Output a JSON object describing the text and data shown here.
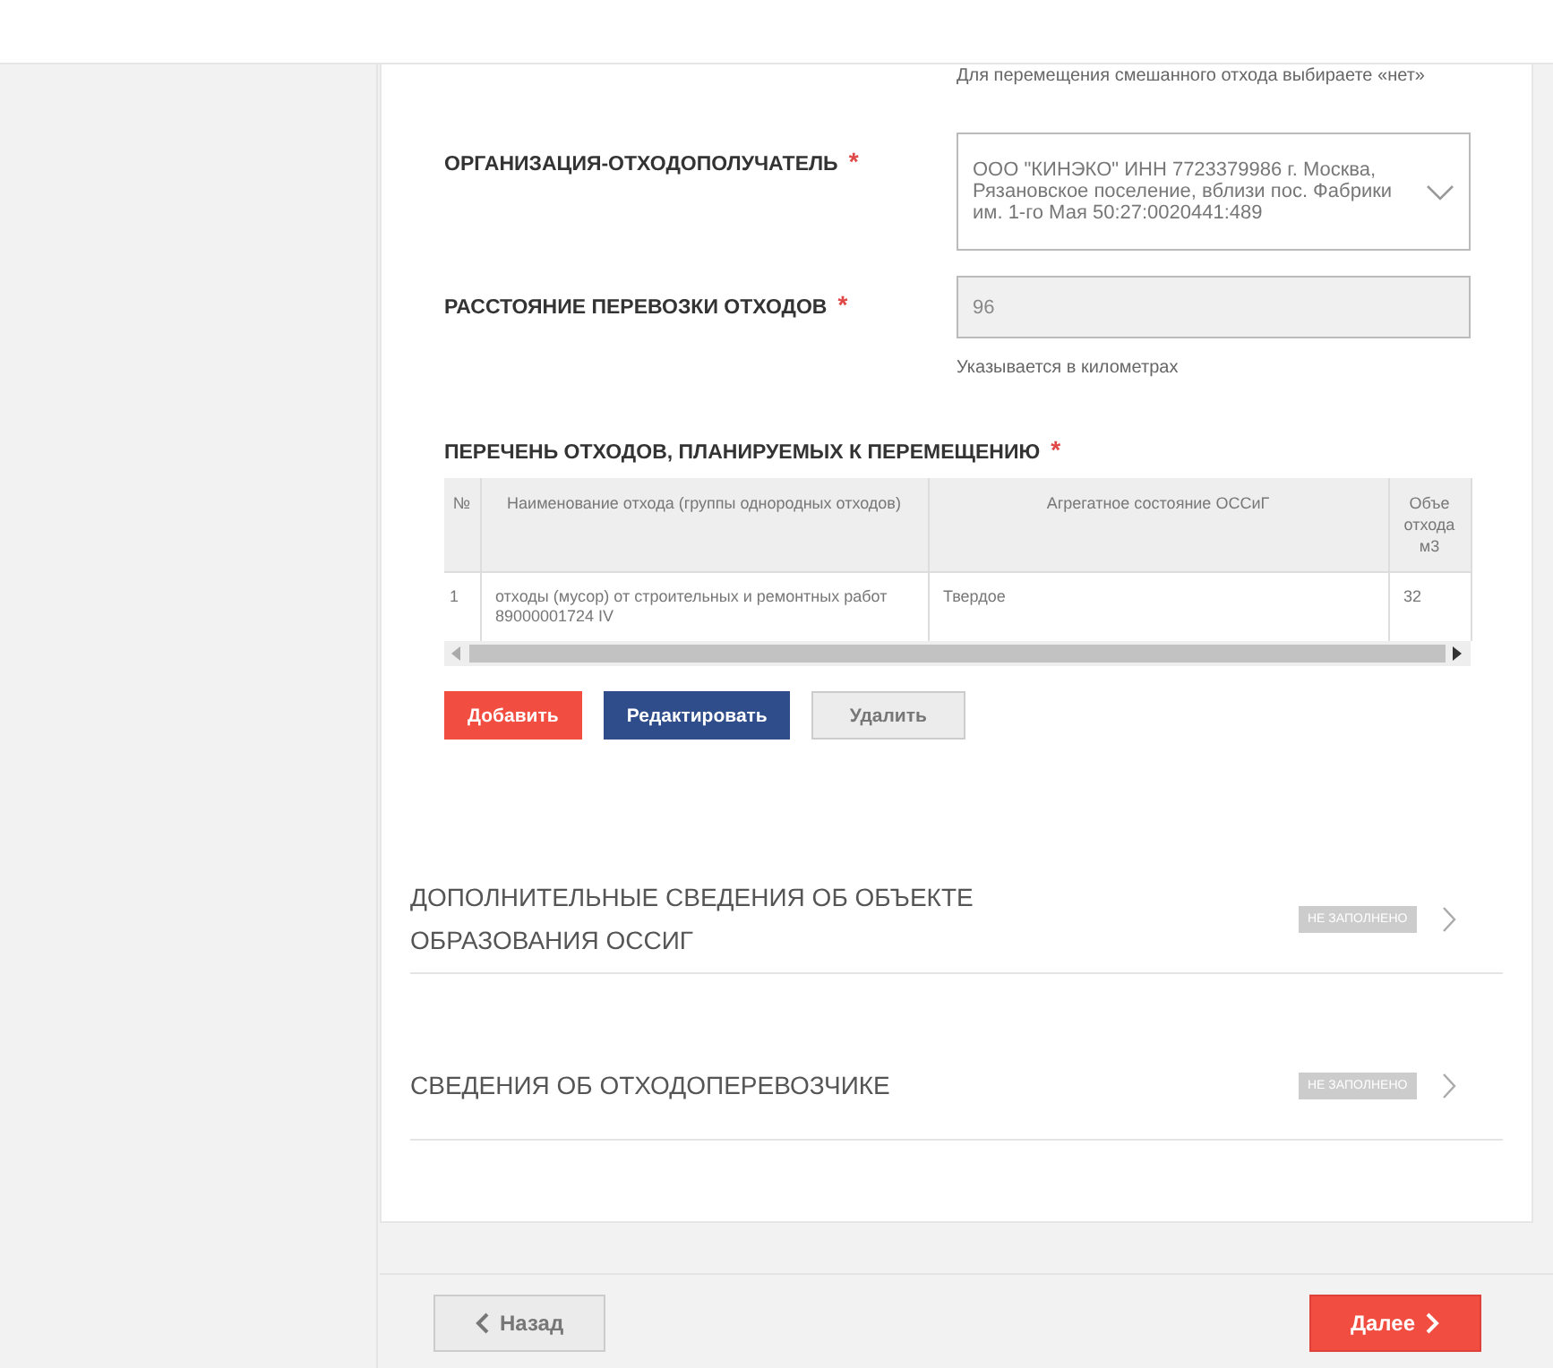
{
  "top_hint": "Для перемещения смешанного отхода выбираете «нет»",
  "fields": [
    {
      "kind": "select",
      "label": "ОРГАНИЗАЦИЯ-ОТХОДОПОЛУЧАТЕЛЬ",
      "required_mark": "*",
      "value": "ООО \"КИНЭКО\" ИНН 7723379986 г. Москва, Рязановское поселение, вблизи пос. Фабрики им. 1-го Мая 50:27:0020441:489",
      "disabled": false
    },
    {
      "kind": "input",
      "label": "РАССТОЯНИЕ ПЕРЕВОЗКИ ОТХОДОВ",
      "required_mark": "*",
      "value": "96",
      "disabled": true,
      "hint": "Указывается в километрах"
    }
  ],
  "waste_list": {
    "title": "ПЕРЕЧЕНЬ ОТХОДОВ, ПЛАНИРУЕМЫХ К ПЕРЕМЕЩЕНИЮ",
    "required_mark": "*",
    "columns": [
      "№",
      "Наименование отхода (группы однородных отходов)",
      "Агрегатное состояние ОССиГ",
      "Объе отхода м3"
    ],
    "rows": [
      [
        "1",
        "отходы (мусор) от строительных и ремонтных работ 89000001724 IV",
        "Твердое",
        "32"
      ]
    ],
    "buttons": [
      {
        "kind": "add",
        "label": "Добавить"
      },
      {
        "kind": "edit",
        "label": "Редактировать"
      },
      {
        "kind": "delete",
        "label": "Удалить"
      }
    ]
  },
  "sections": [
    {
      "title": "ДОПОЛНИТЕЛЬНЫЕ СВЕДЕНИЯ ОБ ОБЪЕКТЕ ОБРАЗОВАНИЯ ОССИГ",
      "status": "НЕ ЗАПОЛНЕНО"
    },
    {
      "title": "СВЕДЕНИЯ ОБ ОТХОДОПЕРЕВОЗЧИКЕ",
      "status": "НЕ ЗАПОЛНЕНО"
    }
  ],
  "footer": {
    "back": "Назад",
    "next": "Далее"
  }
}
